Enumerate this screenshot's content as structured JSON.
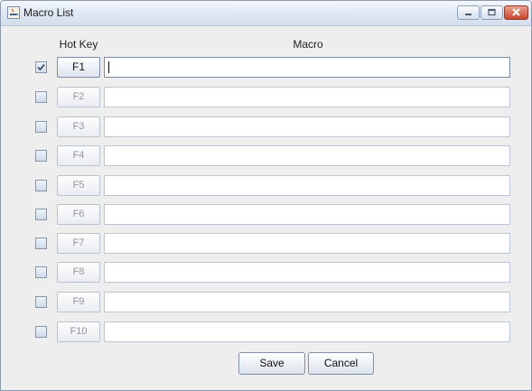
{
  "window": {
    "title": "Macro List"
  },
  "headers": {
    "hotkey": "Hot Key",
    "macro": "Macro"
  },
  "rows": [
    {
      "checked": true,
      "hotkey": "F1",
      "macro": "",
      "enabled": true
    },
    {
      "checked": false,
      "hotkey": "F2",
      "macro": "",
      "enabled": false
    },
    {
      "checked": false,
      "hotkey": "F3",
      "macro": "",
      "enabled": false
    },
    {
      "checked": false,
      "hotkey": "F4",
      "macro": "",
      "enabled": false
    },
    {
      "checked": false,
      "hotkey": "F5",
      "macro": "",
      "enabled": false
    },
    {
      "checked": false,
      "hotkey": "F6",
      "macro": "",
      "enabled": false
    },
    {
      "checked": false,
      "hotkey": "F7",
      "macro": "",
      "enabled": false
    },
    {
      "checked": false,
      "hotkey": "F8",
      "macro": "",
      "enabled": false
    },
    {
      "checked": false,
      "hotkey": "F9",
      "macro": "",
      "enabled": false
    },
    {
      "checked": false,
      "hotkey": "F10",
      "macro": "",
      "enabled": false
    }
  ],
  "buttons": {
    "save": "Save",
    "cancel": "Cancel"
  }
}
